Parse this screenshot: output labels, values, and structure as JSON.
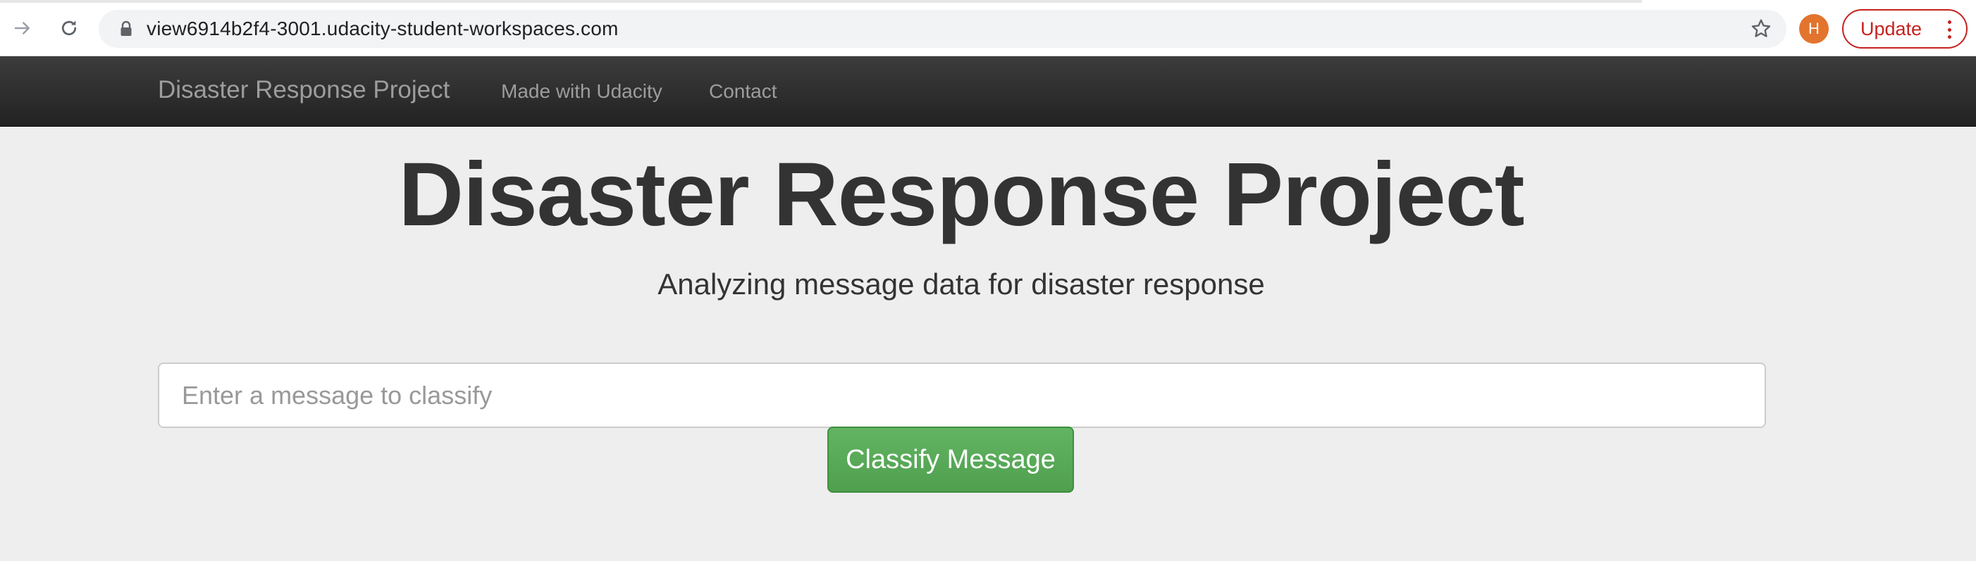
{
  "browser": {
    "url": "view6914b2f4-3001.udacity-student-workspaces.com",
    "avatar_initial": "H",
    "update_label": "Update",
    "icons": {
      "forward": "arrow-forward-icon",
      "reload": "reload-icon",
      "lock": "lock-icon",
      "star": "star-icon",
      "menu": "kebab-menu-icon"
    },
    "colors": {
      "avatar": "#e3742d",
      "update": "#c5221f"
    }
  },
  "navbar": {
    "brand": "Disaster Response Project",
    "links": [
      {
        "label": "Made with Udacity"
      },
      {
        "label": "Contact"
      }
    ]
  },
  "hero": {
    "title": "Disaster Response Project",
    "subtitle": "Analyzing message data for disaster response"
  },
  "form": {
    "input_value": "",
    "input_placeholder": "Enter a message to classify",
    "submit_label": "Classify Message",
    "submit_color": "#5cb85c"
  }
}
